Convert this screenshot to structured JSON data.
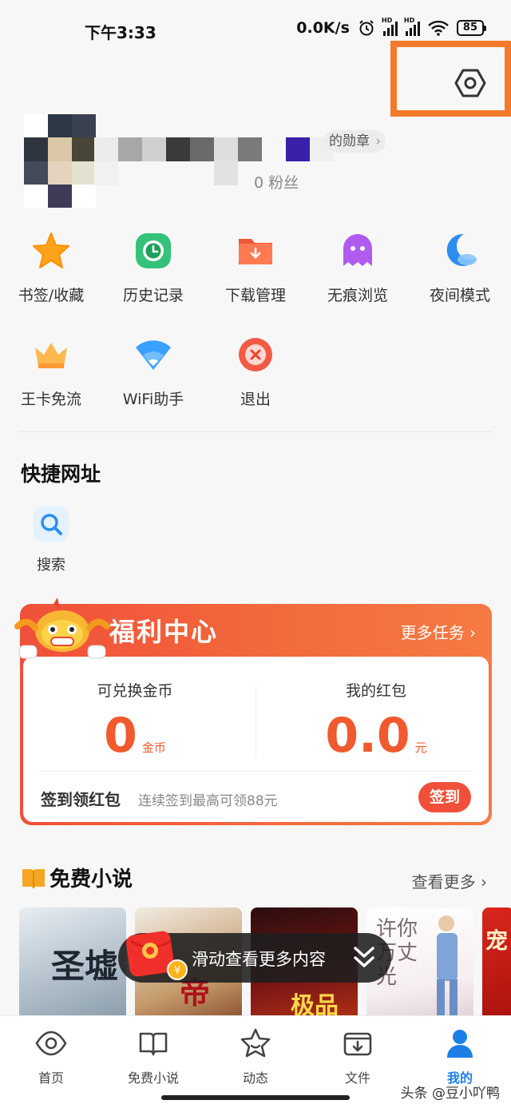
{
  "status_bar": {
    "time": "下午3:33",
    "speed": "0.0K/s",
    "battery": "85"
  },
  "profile": {
    "medal_label": "的勋章",
    "fans_label": "0 粉丝"
  },
  "quick_actions": [
    {
      "label": "书签/收藏",
      "icon": "star-icon"
    },
    {
      "label": "历史记录",
      "icon": "clock-icon"
    },
    {
      "label": "下载管理",
      "icon": "download-folder-icon"
    },
    {
      "label": "无痕浏览",
      "icon": "ghost-icon"
    },
    {
      "label": "夜间模式",
      "icon": "moon-icon"
    },
    {
      "label": "王卡免流",
      "icon": "crown-icon"
    },
    {
      "label": "WiFi助手",
      "icon": "wifi-icon"
    },
    {
      "label": "退出",
      "icon": "exit-icon"
    }
  ],
  "shortcuts": {
    "title": "快捷网址",
    "items": [
      {
        "label": "搜索",
        "icon": "search-icon"
      }
    ]
  },
  "welfare": {
    "title": "福利中心",
    "more": "更多任务",
    "coins_label": "可兑换金币",
    "coins_value": "0",
    "coins_unit": "金币",
    "redpack_label": "我的红包",
    "redpack_value": "0.0",
    "redpack_unit": "元",
    "sign_title": "签到领红包",
    "sign_subtitle": "连续签到最高可领88元",
    "sign_button": "签到"
  },
  "novels": {
    "title": "免费小说",
    "see_more": "查看更多",
    "covers": [
      {
        "text": "圣墟"
      },
      {
        "text": "帝"
      },
      {
        "text": "极品"
      },
      {
        "text": "许你万丈光"
      },
      {
        "text": "宠"
      }
    ]
  },
  "toast": {
    "text": "滑动查看更多内容"
  },
  "bottom_nav": [
    {
      "label": "首页",
      "icon": "eye-icon"
    },
    {
      "label": "免费小说",
      "icon": "book-icon"
    },
    {
      "label": "动态",
      "icon": "star-outline-icon"
    },
    {
      "label": "文件",
      "icon": "file-download-icon"
    },
    {
      "label": "我的",
      "icon": "person-icon",
      "active": true
    }
  ],
  "watermark": "头条 @豆小吖鸭",
  "colors": {
    "accent": "#f05a2e",
    "active_nav": "#1c7fe8",
    "highlight": "#f27a2a"
  }
}
